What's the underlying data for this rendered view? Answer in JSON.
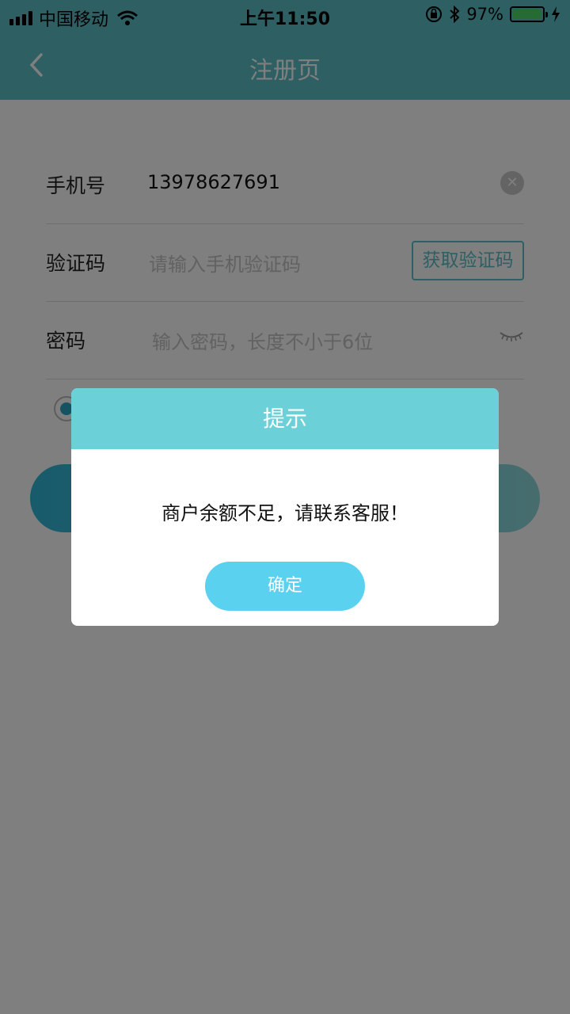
{
  "status_bar": {
    "carrier": "中国移动",
    "time": "上午11:50",
    "battery_percent": "97%",
    "battery_level": 0.97
  },
  "nav": {
    "title": "注册页"
  },
  "form": {
    "phone_label": "手机号",
    "phone_value": "13978627691",
    "code_label": "验证码",
    "code_placeholder": "请输入手机验证码",
    "get_code_label": "获取验证码",
    "password_label": "密码",
    "password_placeholder": "输入密码，长度不小于6位"
  },
  "dialog": {
    "title": "提示",
    "message": "商户余额不足，请联系客服！",
    "confirm_label": "确定"
  },
  "colors": {
    "theme": "#5bbfc7",
    "dialog_header": "#6cd0d8",
    "confirm_button": "#5ad1ee"
  },
  "icons": {
    "back": "chevron-left-icon",
    "clear": "clear-x-icon",
    "password_toggle": "eye-closed-icon"
  }
}
